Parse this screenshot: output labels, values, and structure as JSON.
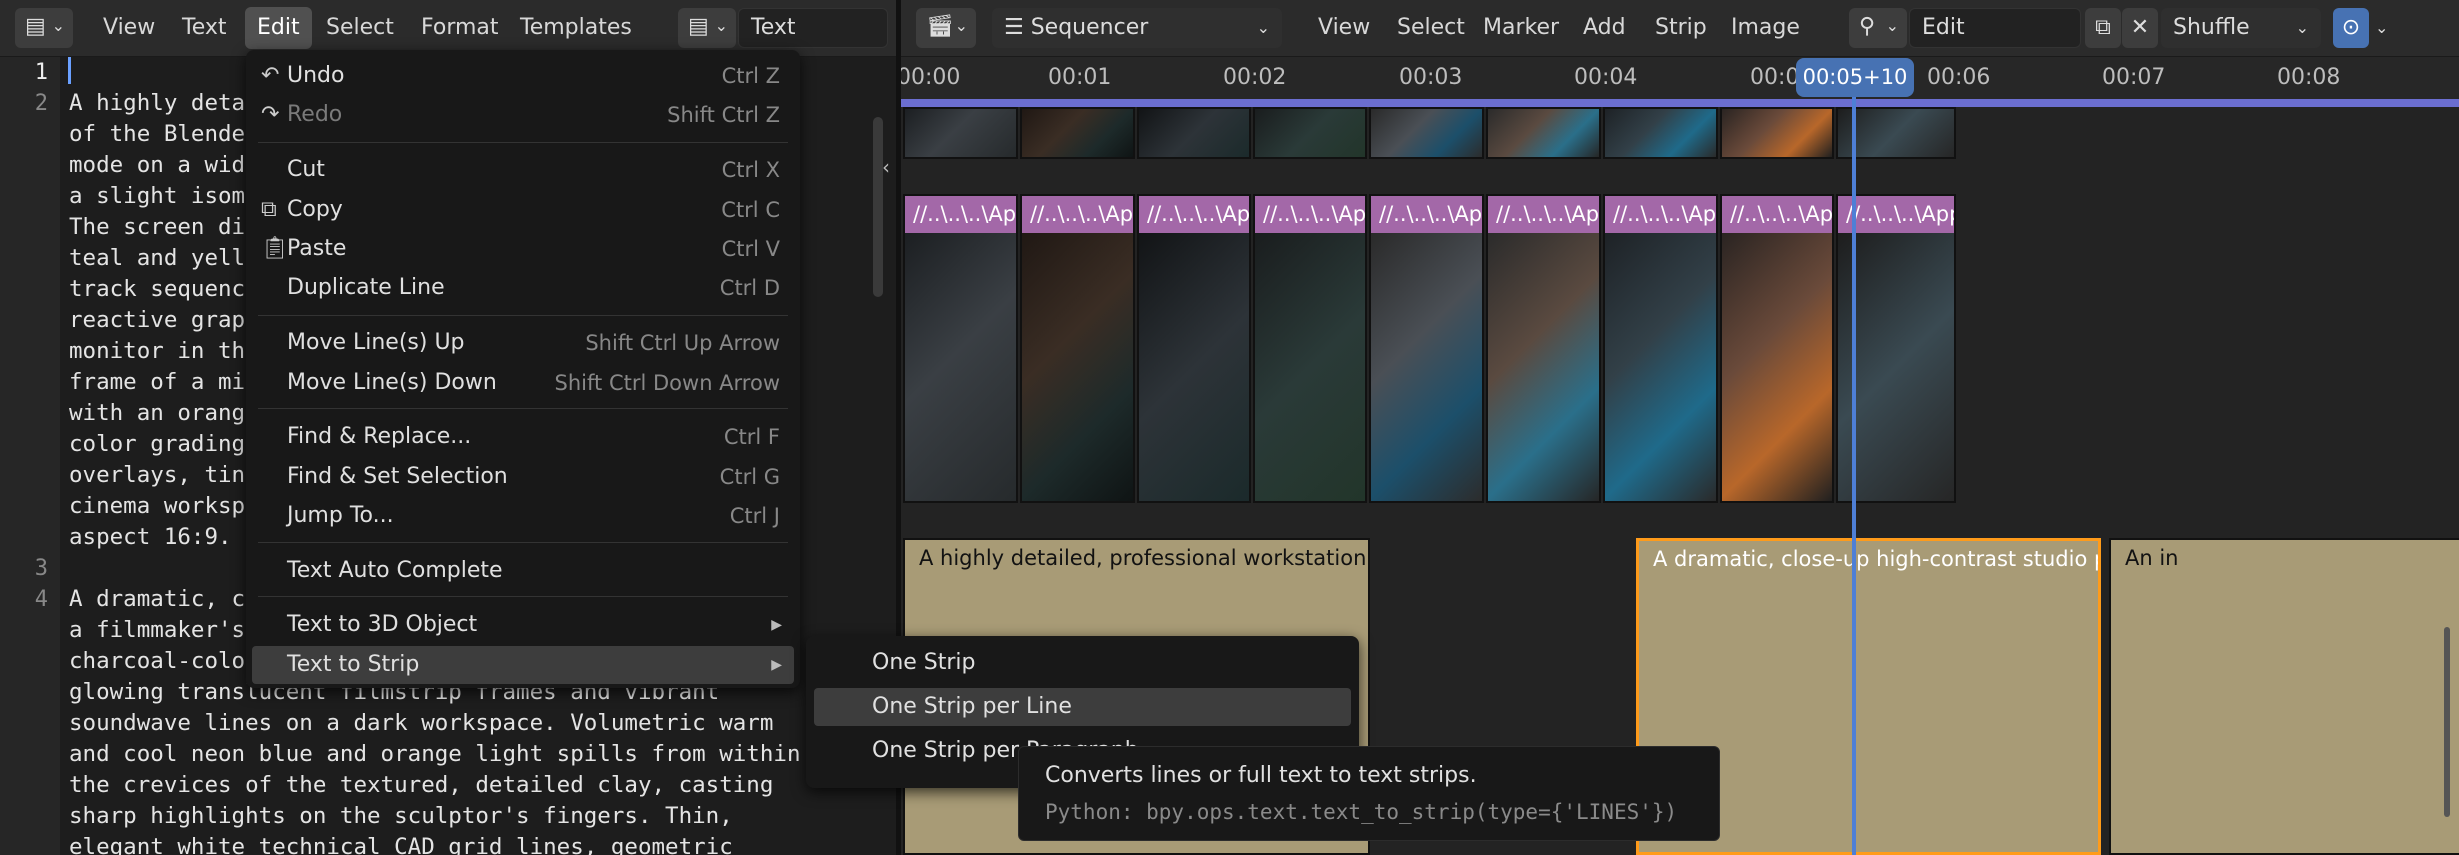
{
  "text_editor": {
    "menu": [
      "View",
      "Text",
      "Edit",
      "Select",
      "Format",
      "Templates"
    ],
    "datablock_name": "Text",
    "line_numbers": [
      "1",
      "2",
      "3",
      "4"
    ],
    "code_lines": [
      "",
      "A highly deta                                     ot",
      "of the Blende                                     rk",
      "mode on a wid                                     at",
      "a slight isom                                     .",
      "The screen di                                     n",
      "teal and yell",
      "track sequenc",
      "reactive grap                                     ew",
      "monitor in th                                     e",
      "frame of a mi                                     sk",
      "with an orang                                     d",
      "color grading",
      "overlays, tin                                     l",
      "cinema worksp",
      "aspect 16:9.",
      "",
      "A dramatic, c                                     of",
      "a filmmaker's",
      "charcoal-colo",
      "glowing translucent filmstrip frames and vibrant",
      "soundwave lines on a dark workspace. Volumetric warm",
      "and cool neon blue and orange light spills from within",
      "the crevices of the textured, detailed clay, casting",
      "sharp highlights on the sculptor's fingers. Thin,",
      "elegant white technical CAD grid lines, geometric"
    ]
  },
  "edit_menu": {
    "items": [
      {
        "label": "Undo",
        "shortcut": "Ctrl Z",
        "icon": "undo-icon"
      },
      {
        "label": "Redo",
        "shortcut": "Shift Ctrl Z",
        "icon": "redo-icon",
        "disabled": true
      },
      {
        "label": "Cut",
        "shortcut": "Ctrl X"
      },
      {
        "label": "Copy",
        "shortcut": "Ctrl C",
        "icon": "copy-icon"
      },
      {
        "label": "Paste",
        "shortcut": "Ctrl V",
        "icon": "paste-icon"
      },
      {
        "label": "Duplicate Line",
        "shortcut": "Ctrl D"
      },
      {
        "label": "Move Line(s) Up",
        "shortcut": "Shift Ctrl Up Arrow"
      },
      {
        "label": "Move Line(s) Down",
        "shortcut": "Shift Ctrl Down Arrow"
      },
      {
        "label": "Find & Replace...",
        "shortcut": "Ctrl F"
      },
      {
        "label": "Find & Set Selection",
        "shortcut": "Ctrl G"
      },
      {
        "label": "Jump To...",
        "shortcut": "Ctrl J"
      },
      {
        "label": "Text Auto Complete",
        "shortcut": ""
      },
      {
        "label": "Text to 3D Object",
        "shortcut": ""
      },
      {
        "label": "Text to Strip",
        "shortcut": ""
      }
    ]
  },
  "submenu": {
    "items": [
      "One Strip",
      "One Strip per Line",
      "One Strip per Paragraph"
    ]
  },
  "tooltip": {
    "description": "Converts lines or full text to text strips.",
    "python": "Python: bpy.ops.text.text_to_strip(type={'LINES'})"
  },
  "sequencer": {
    "editor_name": "Sequencer",
    "menu": [
      "View",
      "Select",
      "Marker",
      "Add",
      "Strip",
      "Image"
    ],
    "edit_field": "Edit",
    "shuffle": "Shuffle",
    "timecodes": [
      "00:00",
      "00:01",
      "00:02",
      "00:03",
      "00:04",
      "00:05",
      "00:06",
      "00:07",
      "00:08"
    ],
    "playhead": "00:05+10",
    "image_strip_label": "//..\\..\\..\\AppDat",
    "text_strips": [
      "A highly detailed, professional workstation screenshot of the Blender",
      "A dramatic, close-up high-contrast studio photograph of a filmmaker",
      "An in"
    ]
  },
  "colors": {
    "image_strip_header": "#a368a8",
    "text_strip": "#a89b76",
    "selected_outline": "#ff9b1a",
    "playhead": "#4772b3",
    "range_bar": "#6b6ed0"
  }
}
